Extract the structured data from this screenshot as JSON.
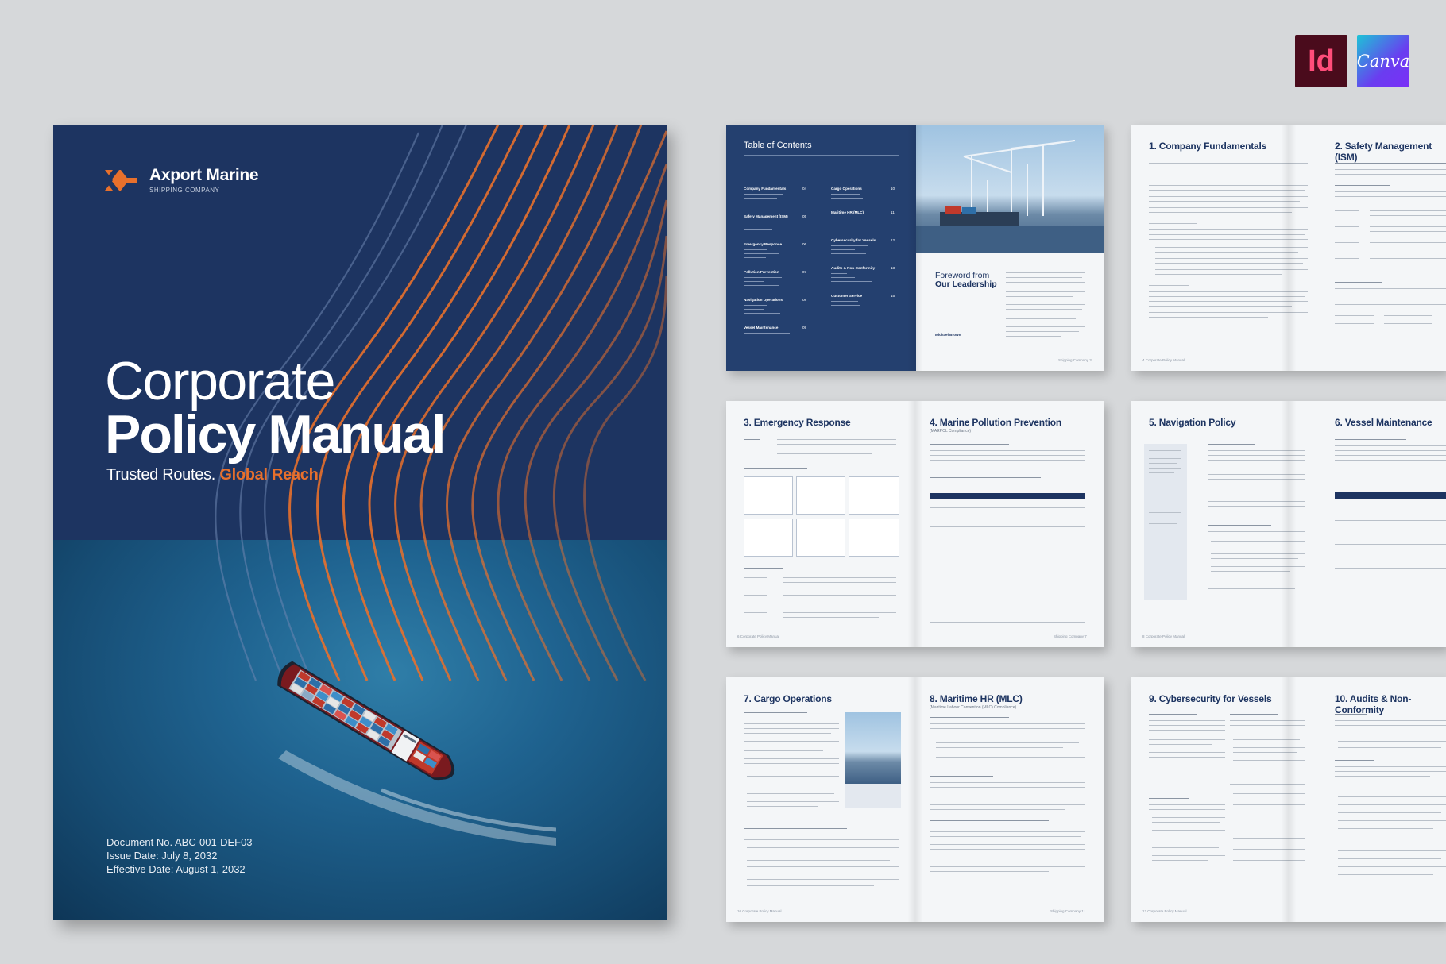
{
  "badges": {
    "indesign": "Id",
    "canva": "Canva"
  },
  "cover": {
    "brand_name": "Axport Marine",
    "brand_sub": "SHIPPING COMPANY",
    "title_line1": "Corporate",
    "title_line2": "Policy Manual",
    "tagline_main": "Trusted Routes.",
    "tagline_accent": "Global Reach",
    "doc_no": "Document No. ABC-001-DEF03",
    "issue_date": "Issue Date: July 8, 2032",
    "effective_date": "Effective Date: August 1, 2032",
    "colors": {
      "navy": "#1d3461",
      "accent": "#e8702c",
      "sea": "#1f6390"
    }
  },
  "toc": {
    "title": "Table of Contents",
    "left_col": [
      {
        "label": "Company Fundamentals",
        "num": "04"
      },
      {
        "label": "Safety Management (ISM)",
        "num": "05"
      },
      {
        "label": "Emergency Response",
        "num": "06"
      },
      {
        "label": "Pollution Prevention",
        "num": "07"
      },
      {
        "label": "Navigation Operations",
        "num": "08"
      },
      {
        "label": "Vessel Maintenance",
        "num": "09"
      }
    ],
    "right_col": [
      {
        "label": "Cargo Operations",
        "num": "10"
      },
      {
        "label": "Maritime HR (MLC)",
        "num": "11"
      },
      {
        "label": "Cybersecurity for Vessels",
        "num": "12"
      },
      {
        "label": "Audits & Non-Conformity",
        "num": "13"
      },
      {
        "label": "Customer Service",
        "num": "15"
      }
    ],
    "foreword_line1": "Foreword from",
    "foreword_line2": "Our Leadership",
    "signer": "Michael Brown",
    "footer_right": "Shipping Company 3"
  },
  "spreads": {
    "s1_right_title": "1. Company Fundamentals",
    "s1_right_title2": "2. Safety Management (ISM)",
    "s1_footer": "4 Corporate Policy Manual",
    "s2_left_title": "3. Emergency Response",
    "s2_right_title": "4. Marine Pollution Prevention",
    "s2_right_sub": "(MARPOL Compliance)",
    "s2_footer_left": "6 Corporate Policy Manual",
    "s2_footer_right": "Shipping Company 7",
    "s3_left_title": "5. Navigation Policy",
    "s3_right_title": "6. Vessel Maintenance",
    "s3_footer": "8 Corporate Policy Manual",
    "s4_left_title": "7. Cargo Operations",
    "s4_right_title": "8. Maritime HR (MLC)",
    "s4_right_sub": "(Maritime Labour Convention (MLC) Compliance)",
    "s4_footer_left": "10 Corporate Policy Manual",
    "s4_footer_right": "Shipping Company 11",
    "s5_left_title": "9. Cybersecurity for Vessels",
    "s5_right_title": "10. Audits & Non-Conformity",
    "s5_footer": "12 Corporate Policy Manual"
  }
}
